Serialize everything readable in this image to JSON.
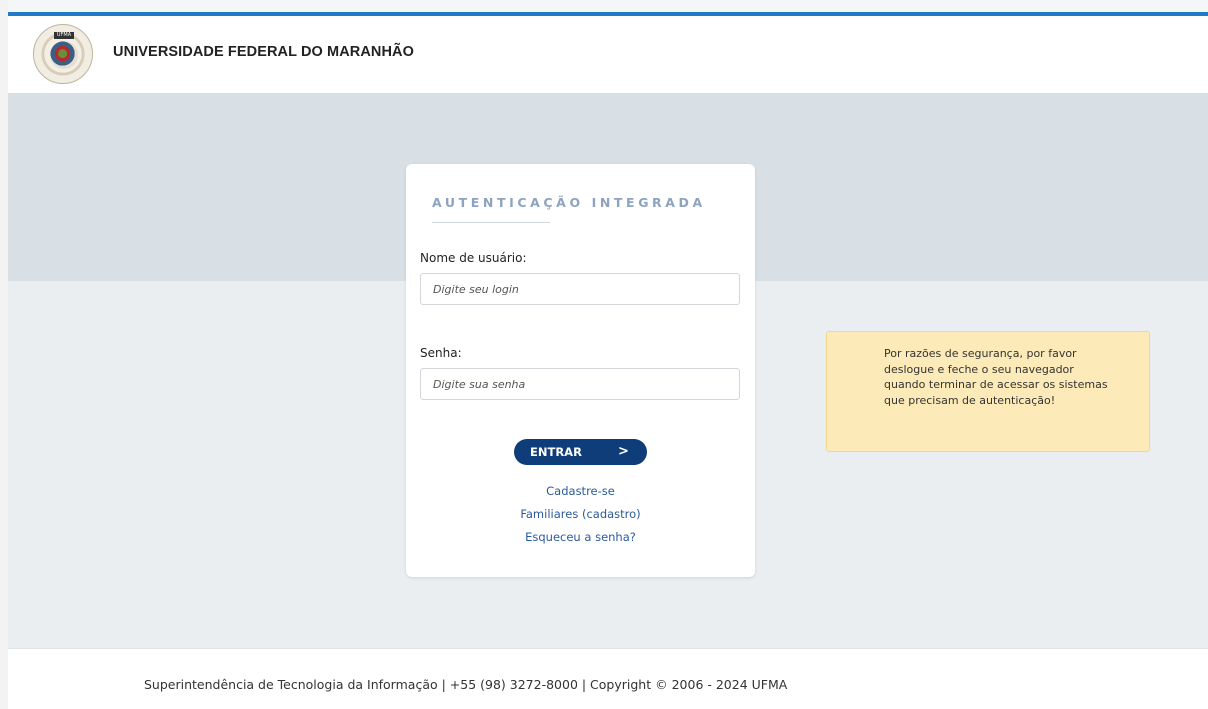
{
  "header": {
    "university_name": "UNIVERSIDADE FEDERAL DO MARANHÃO",
    "logo_tag": "UFMA",
    "accent_color": "#1f7ac8"
  },
  "login": {
    "title": "AUTENTICAÇÃO INTEGRADA",
    "username_label": "Nome de usuário:",
    "username_placeholder": "Digite seu login",
    "password_label": "Senha:",
    "password_placeholder": "Digite sua senha",
    "submit_label": "ENTRAR",
    "submit_arrow": ">",
    "links": {
      "register": "Cadastre-se",
      "family": "Familiares (cadastro)",
      "forgot": "Esqueceu a senha?"
    },
    "button_color": "#0f3d7a"
  },
  "notice": {
    "text": "Por razões de segurança, por favor deslogue e feche o seu navegador quando terminar de acessar os sistemas que precisam de autenticação!",
    "background": "#fcebb8"
  },
  "footer": {
    "text": "Superintendência de Tecnologia da Informação | +55 (98) 3272-8000 | Copyright © 2006 - 2024 UFMA"
  }
}
